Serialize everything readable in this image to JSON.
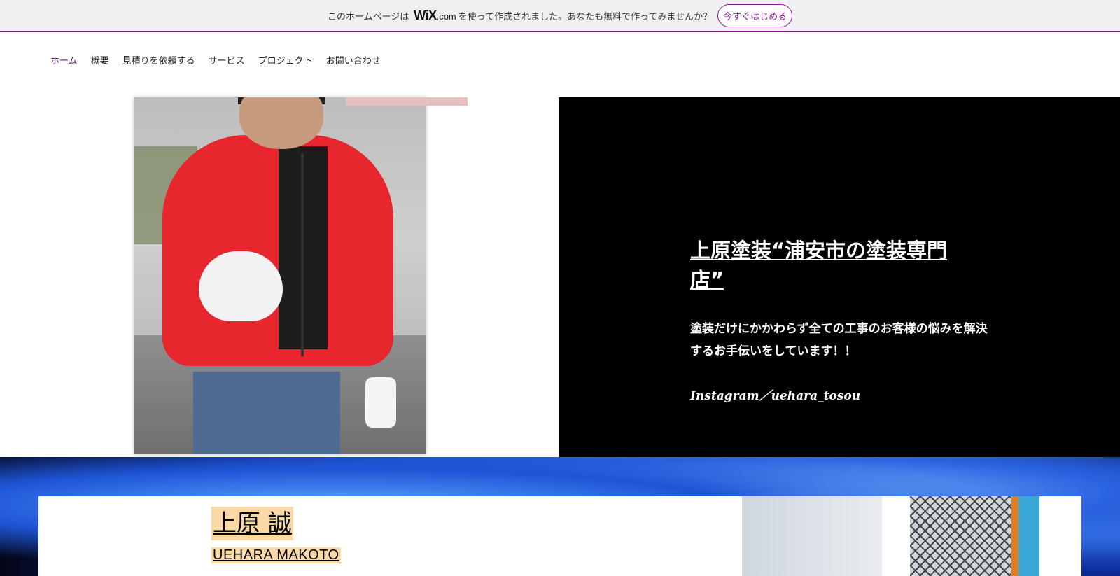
{
  "wix_banner": {
    "text": "このホームページは",
    "logo": "WiX",
    "logo_suffix": ".com",
    "text_after": "を使って作成されました。あなたも無料で作ってみませんか？",
    "cta": "今すぐはじめる",
    "accent_color": "#8e1a95"
  },
  "nav": {
    "items": [
      "ホーム",
      "概要",
      "見積りを依頼する",
      "サービス",
      "プロジェクト",
      "お問い合わせ"
    ]
  },
  "hero": {
    "title": "上原塗装“浦安市の塗装専門店”",
    "description": "塗装だけにかかわらず全ての工事のお客様の悩みを解決するお手伝いをしています！！",
    "instagram": "Instagram／uehara_tosou"
  },
  "profile": {
    "name_jp": "上原 誠",
    "name_en": "UEHARA MAKOTO",
    "highlight_color": "#fbd9a6"
  }
}
